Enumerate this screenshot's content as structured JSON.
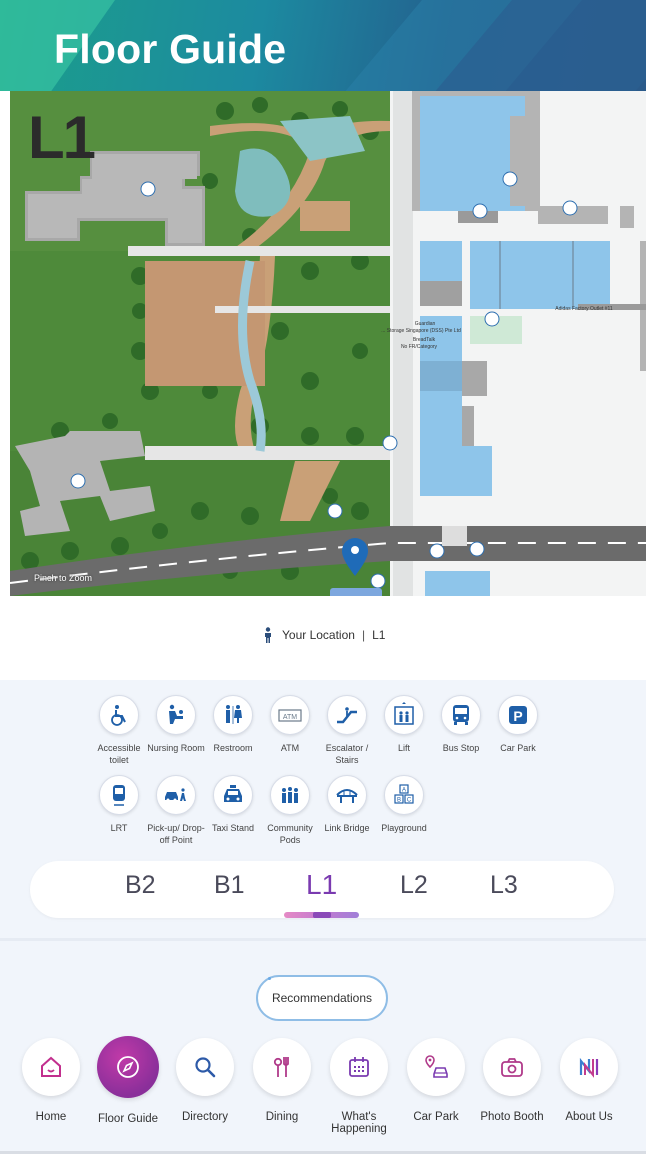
{
  "header": {
    "title": "Floor Guide"
  },
  "map": {
    "floor_label": "L1",
    "pinch_hint": "Pinch to Zoom",
    "shop_labels": [
      "Guardian",
      "... Storage Singapore (DSS) Pte Ltd",
      "BreadTalk",
      "No FR/Category",
      "Adidas Factory Outlet #11"
    ]
  },
  "location": {
    "label": "Your Location",
    "floor": "L1"
  },
  "legend": {
    "items": [
      {
        "label": "Accessible toilet",
        "icon": "wheelchair-icon"
      },
      {
        "label": "Nursing Room",
        "icon": "nursing-icon"
      },
      {
        "label": "Restroom",
        "icon": "restroom-icon"
      },
      {
        "label": "ATM",
        "icon": "atm-icon"
      },
      {
        "label": "Escalator / Stairs",
        "icon": "escalator-icon"
      },
      {
        "label": "Lift",
        "icon": "lift-icon"
      },
      {
        "label": "Bus Stop",
        "icon": "bus-icon"
      },
      {
        "label": "Car Park",
        "icon": "parking-icon"
      },
      {
        "label": "LRT",
        "icon": "train-icon"
      },
      {
        "label": "Pick-up/ Drop-off Point",
        "icon": "car-person-icon"
      },
      {
        "label": "Taxi Stand",
        "icon": "taxi-icon"
      },
      {
        "label": "Community Pods",
        "icon": "community-icon"
      },
      {
        "label": "Link Bridge",
        "icon": "bridge-icon"
      },
      {
        "label": "Playground",
        "icon": "blocks-icon"
      }
    ]
  },
  "floors": {
    "tabs": [
      "B2",
      "B1",
      "L1",
      "L2",
      "L3"
    ],
    "active": "L1"
  },
  "recommendations": {
    "label": "Recommendations"
  },
  "nav": {
    "items": [
      {
        "label": "Home",
        "icon": "home-icon"
      },
      {
        "label": "Floor Guide",
        "icon": "compass-icon",
        "active": true
      },
      {
        "label": "Directory",
        "icon": "search-icon"
      },
      {
        "label": "Dining",
        "icon": "cutlery-icon"
      },
      {
        "label": "What's Happening",
        "icon": "calendar-icon"
      },
      {
        "label": "Car Park",
        "icon": "car-location-icon"
      },
      {
        "label": "Photo Booth",
        "icon": "camera-icon"
      },
      {
        "label": "About Us",
        "icon": "logo-icon"
      }
    ]
  },
  "colors": {
    "header_start": "#1b9f8a",
    "header_end": "#2a5a8a",
    "accent_purple": "#7a3ab0",
    "nav_active": "#a0339f",
    "unit_blue": "#8ec5ea",
    "grass": "#4e8a3a"
  }
}
